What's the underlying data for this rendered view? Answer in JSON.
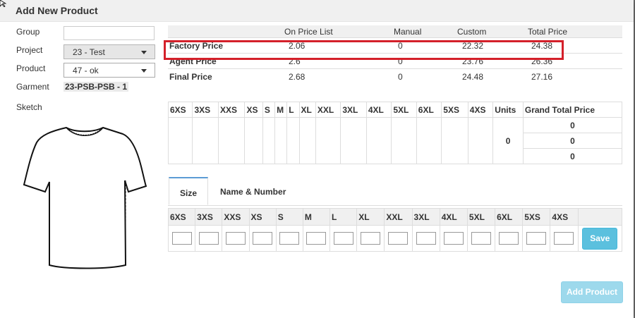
{
  "dialog": {
    "title": "Add New Product"
  },
  "form": {
    "group_label": "Group",
    "group_value": "",
    "project_label": "Project",
    "project_value": "23 - Test",
    "product_label": "Product",
    "product_value": "47 - ok",
    "garment_label": "Garment",
    "garment_value": "23-PSB-PSB - 1",
    "sketch_label": "Sketch"
  },
  "price_table": {
    "headers": [
      "",
      "On Price List",
      "Manual",
      "Custom",
      "Total Price"
    ],
    "rows": [
      {
        "label": "Factory Price",
        "on_price_list": "2.06",
        "manual": "0",
        "custom": "22.32",
        "total": "24.38",
        "highlighted": true
      },
      {
        "label": "Agent Price",
        "on_price_list": "2.6",
        "manual": "0",
        "custom": "23.76",
        "total": "26.36",
        "highlighted": false
      },
      {
        "label": "Final Price",
        "on_price_list": "2.68",
        "manual": "0",
        "custom": "24.48",
        "total": "27.16",
        "highlighted": false
      }
    ]
  },
  "size_grid": {
    "headers": [
      "6XS",
      "3XS",
      "XXS",
      "XS",
      "S",
      "M",
      "L",
      "XL",
      "XXL",
      "3XL",
      "4XL",
      "5XL",
      "6XL",
      "5XS",
      "4XS",
      "Units",
      "Grand Total Price"
    ],
    "units": "0",
    "grand_totals": [
      "0",
      "0",
      "0"
    ]
  },
  "tabs": [
    {
      "label": "Size",
      "active": true
    },
    {
      "label": "Name & Number",
      "active": false
    }
  ],
  "size_inputs": {
    "headers": [
      "6XS",
      "3XS",
      "XXS",
      "XS",
      "S",
      "M",
      "L",
      "XL",
      "XXL",
      "3XL",
      "4XL",
      "5XL",
      "6XL",
      "5XS",
      "4XS",
      ""
    ],
    "save_label": "Save"
  },
  "footer": {
    "add_product_label": "Add Product"
  },
  "colors": {
    "highlight": "#d4202a",
    "accent_button": "#5bc0de",
    "disabled_button": "#9dd9ec",
    "active_tab_top": "#5b9bd5"
  }
}
